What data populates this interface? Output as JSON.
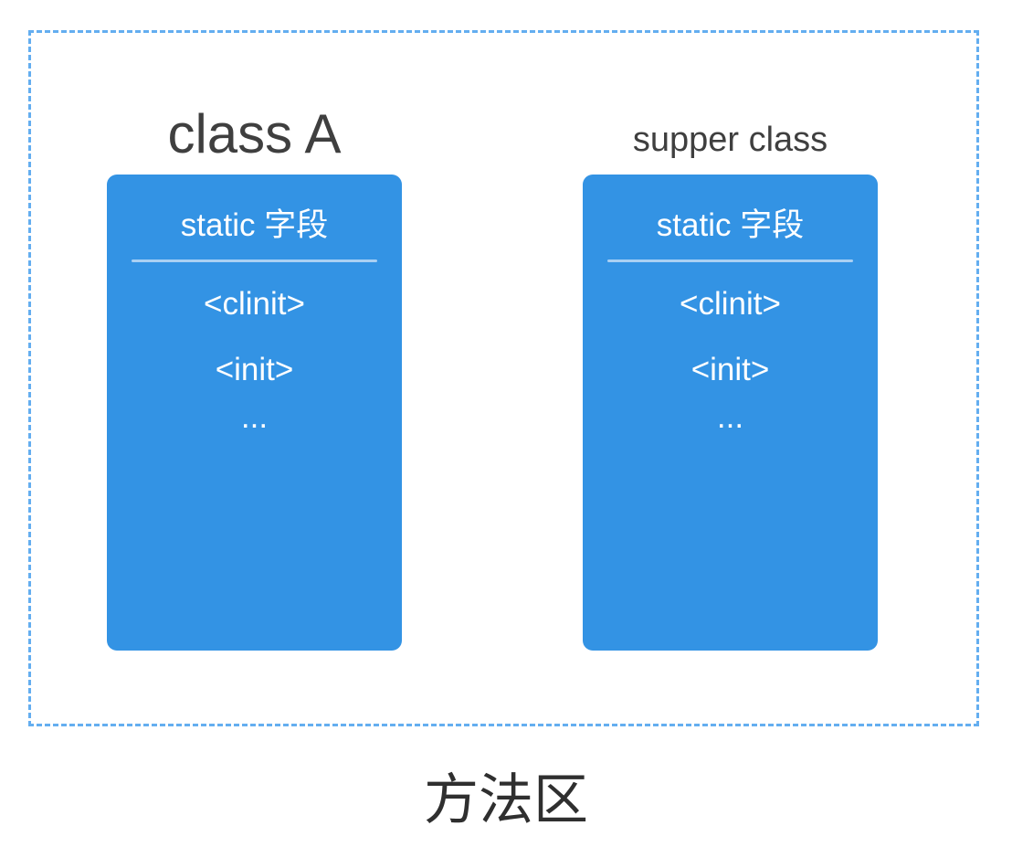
{
  "region_label": "方法区",
  "classes": [
    {
      "title": "class A",
      "field": "static 字段",
      "methods": [
        "<clinit>",
        "<init>",
        "..."
      ]
    },
    {
      "title": "supper class",
      "field": "static 字段",
      "methods": [
        "<clinit>",
        "<init>",
        "..."
      ]
    }
  ],
  "colors": {
    "card": "#3393e4",
    "border": "#64aef0",
    "divider": "#a9d0f3",
    "text_dark": "#3f3f3f"
  }
}
